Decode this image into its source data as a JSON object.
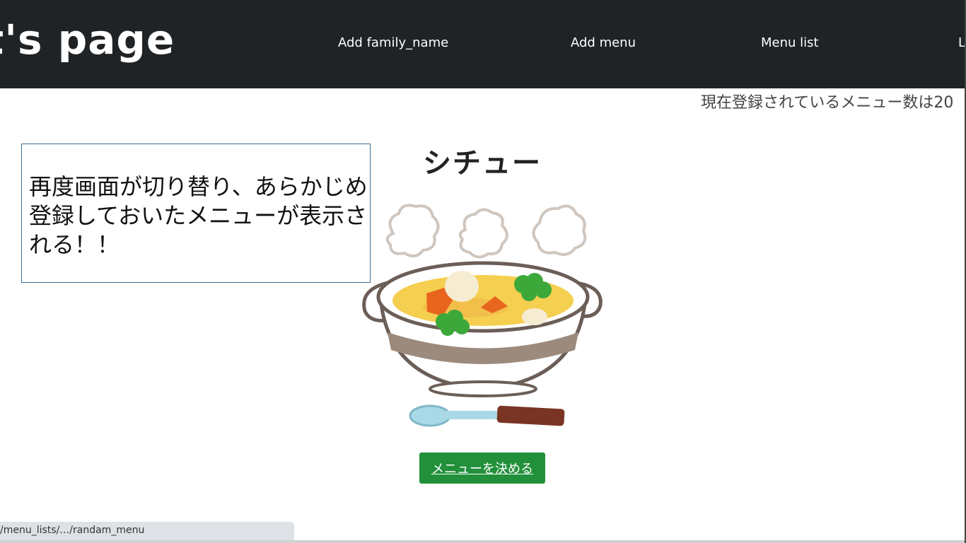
{
  "header": {
    "site_title": "st's page",
    "nav": {
      "add_family_name": "Add family_name",
      "add_menu": "Add menu",
      "menu_list": "Menu list",
      "cut_item": "L"
    }
  },
  "status": {
    "registered_count_text": "現在登録されているメニュー数は20"
  },
  "callout": {
    "text": "再度画面が切り替り、あらかじめ登録しておいたメニューが表示される！！"
  },
  "menu": {
    "title": "シチュー",
    "decide_button": "メニューを決める"
  },
  "statusbar": {
    "url": "/menu_lists/…/randam_menu"
  },
  "colors": {
    "header_bg": "#1f2325",
    "button_green": "#22903a",
    "callout_border": "#3a6f94"
  }
}
